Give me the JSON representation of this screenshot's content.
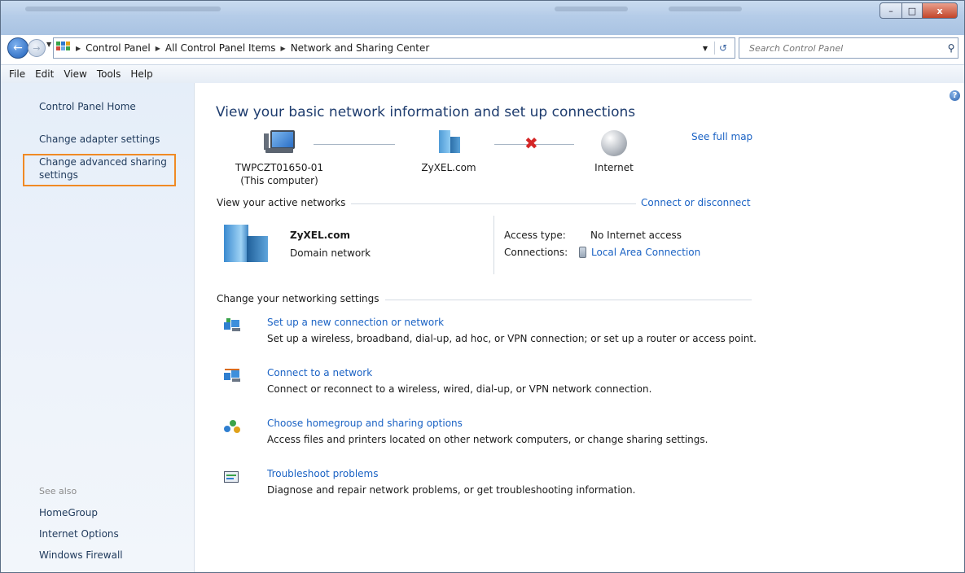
{
  "titlebar": {
    "controls": {
      "minimize": "–",
      "maximize": "□",
      "close": "x"
    }
  },
  "address": {
    "breadcrumbs": [
      "Control Panel",
      "All Control Panel Items",
      "Network and Sharing Center"
    ],
    "search_placeholder": "Search Control Panel"
  },
  "menu": [
    "File",
    "Edit",
    "View",
    "Tools",
    "Help"
  ],
  "sidebar": {
    "links": [
      "Control Panel Home",
      "Change adapter settings",
      "Change advanced sharing settings"
    ],
    "see_also_title": "See also",
    "see_also": [
      "HomeGroup",
      "Internet Options",
      "Windows Firewall"
    ],
    "highlight_color": "#f08a24"
  },
  "main": {
    "title": "View your basic network information and set up connections",
    "see_full_map": "See full map",
    "map": {
      "computer_name": "TWPCZT01650-01",
      "computer_sub": "(This computer)",
      "network": "ZyXEL.com",
      "internet": "Internet"
    },
    "active_networks": {
      "heading": "View your active networks",
      "connect_link": "Connect or disconnect",
      "network_name": "ZyXEL.com",
      "network_type": "Domain network",
      "access_type_label": "Access type:",
      "access_type_value": "No Internet access",
      "connections_label": "Connections:",
      "connections_value": "Local Area Connection"
    },
    "settings": {
      "heading": "Change your networking settings",
      "tasks": [
        {
          "link": "Set up a new connection or network",
          "desc": "Set up a wireless, broadband, dial-up, ad hoc, or VPN connection; or set up a router or access point."
        },
        {
          "link": "Connect to a network",
          "desc": "Connect or reconnect to a wireless, wired, dial-up, or VPN network connection."
        },
        {
          "link": "Choose homegroup and sharing options",
          "desc": "Access files and printers located on other network computers, or change sharing settings."
        },
        {
          "link": "Troubleshoot problems",
          "desc": "Diagnose and repair network problems, or get troubleshooting information."
        }
      ]
    }
  },
  "colors": {
    "link": "#1a62c4",
    "title": "#1e3c6e",
    "sidebar_link": "#1e395b"
  }
}
